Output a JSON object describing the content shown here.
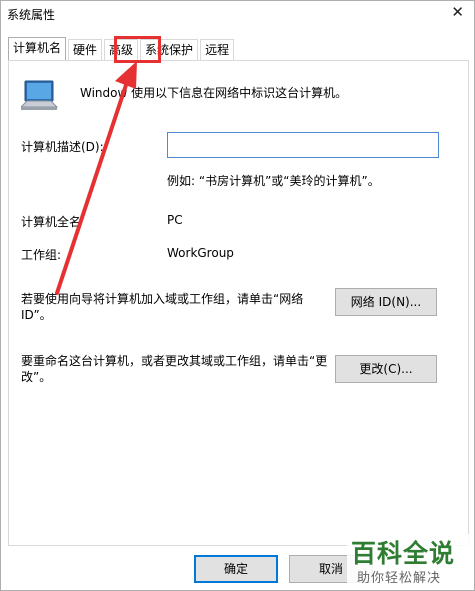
{
  "window": {
    "title": "系统属性",
    "close_glyph": "✕"
  },
  "tabs": [
    {
      "label": "计算机名",
      "active": true
    },
    {
      "label": "硬件",
      "active": false
    },
    {
      "label": "高级",
      "active": false
    },
    {
      "label": "系统保护",
      "active": false
    },
    {
      "label": "远程",
      "active": false
    }
  ],
  "panel": {
    "intro_text": "Window 使用以下信息在网络中标识这台计算机。",
    "description_label": "计算机描述(D):",
    "description_value": "",
    "example_text": "例如: “书房计算机”或“美玲的计算机”。",
    "full_name_label": "计算机全名",
    "full_name_value": "PC",
    "workgroup_label": "工作组:",
    "workgroup_value": "WorkGroup",
    "network_id_text": "若要使用向导将计算机加入域或工作组，请单击“网络 ID”。",
    "network_id_button": "网络 ID(N)...",
    "rename_text": "要重命名这台计算机，或者更改其域或工作组，请单击“更改”。",
    "change_button": "更改(C)..."
  },
  "footer": {
    "ok_button": "确定",
    "cancel_button": "取消"
  },
  "watermark": {
    "main": "百科全说",
    "sub": "助你轻松解决"
  },
  "colors": {
    "highlight": "#e53131",
    "arrow": "#e53131",
    "watermark": "#2e7d32"
  },
  "icons": {
    "computer": "computer-monitor-icon"
  }
}
